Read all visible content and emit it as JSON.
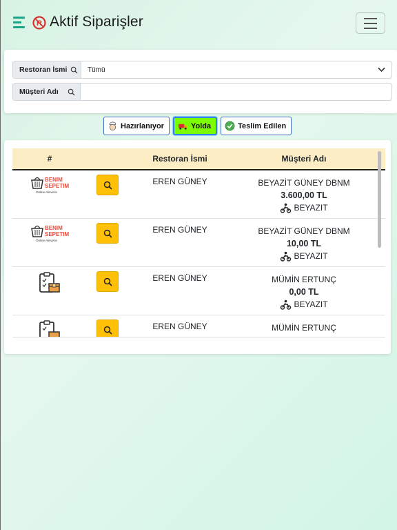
{
  "header": {
    "title": "Aktif Siparişler",
    "brand_color": "#17a589"
  },
  "filters": {
    "restaurant_label": "Restoran İsmi",
    "restaurant_value": "Tümü",
    "customer_label": "Müşteri Adı",
    "customer_value": ""
  },
  "tabs": [
    {
      "label": "Hazırlanıyor",
      "icon": "chef-icon",
      "active": false
    },
    {
      "label": "Yolda",
      "icon": "delivery-truck-icon",
      "active": true
    },
    {
      "label": "Teslim Edilen",
      "icon": "check-circle-icon",
      "active": false
    }
  ],
  "table": {
    "columns": [
      "#",
      "",
      "Restoran İsmi",
      "Müşteri Adı"
    ],
    "rows": [
      {
        "logo": "benim-sepetim-logo",
        "logo_text": [
          "BENIM",
          "SEPETIM",
          "Online Alisveris"
        ],
        "restaurant": "EREN GÜNEY",
        "customer": "BEYAZİT GÜNEY DBNM",
        "amount": "3.600,00 TL",
        "courier": "BEYAZIT"
      },
      {
        "logo": "benim-sepetim-logo",
        "logo_text": [
          "BENIM",
          "SEPETIM",
          "Online Alisveris"
        ],
        "restaurant": "EREN GÜNEY",
        "customer": "BEYAZİT GÜNEY DBNM",
        "amount": "10,00 TL",
        "courier": "BEYAZIT"
      },
      {
        "logo": "clipboard-box-icon",
        "restaurant": "EREN GÜNEY",
        "customer": "MÜMİN ERTUNÇ",
        "amount": "0,00 TL",
        "courier": "BEYAZIT"
      },
      {
        "logo": "clipboard-box-icon",
        "restaurant": "EREN GÜNEY",
        "customer": "MÜMİN ERTUNÇ",
        "amount": "",
        "courier": ""
      }
    ]
  },
  "colors": {
    "table_header_bg": "#fdedc5",
    "search_button": "#ffc107",
    "active_tab_bg": "#7cfc00"
  }
}
